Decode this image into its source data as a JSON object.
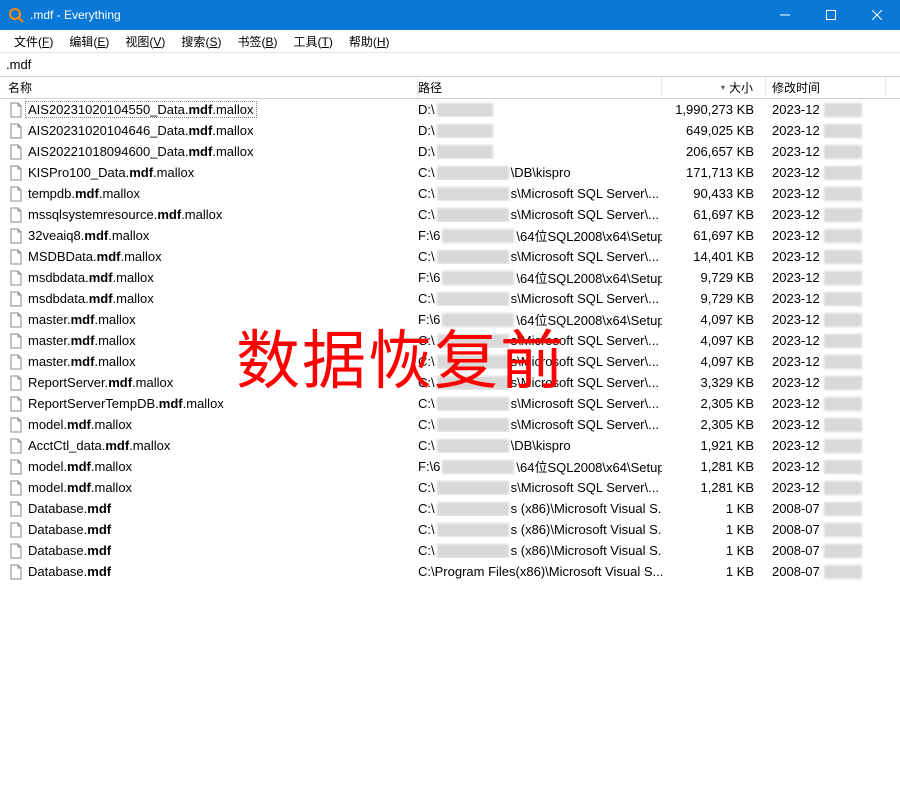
{
  "window": {
    "title": ".mdf - Everything"
  },
  "menu": {
    "file": {
      "label": "文件",
      "acc": "F"
    },
    "edit": {
      "label": "编辑",
      "acc": "E"
    },
    "view": {
      "label": "视图",
      "acc": "V"
    },
    "search": {
      "label": "搜索",
      "acc": "S"
    },
    "book": {
      "label": "书签",
      "acc": "B"
    },
    "tools": {
      "label": "工具",
      "acc": "T"
    },
    "help": {
      "label": "帮助",
      "acc": "H"
    }
  },
  "search_value": ".mdf",
  "columns": {
    "name": "名称",
    "path": "路径",
    "size": "大小",
    "date": "修改时间"
  },
  "overlay": "数据恢复前",
  "rows": [
    {
      "name_pre": "AIS20231020104550_Data.",
      "name_bold": "mdf",
      "name_post": ".mallox",
      "path_a": "D:\\",
      "path_b_w": 56,
      "path_c": "",
      "size": "1,990,273 KB",
      "date": "2023-12",
      "selected": true
    },
    {
      "name_pre": "AIS20231020104646_Data.",
      "name_bold": "mdf",
      "name_post": ".mallox",
      "path_a": "D:\\",
      "path_b_w": 56,
      "path_c": "",
      "size": "649,025 KB",
      "date": "2023-12"
    },
    {
      "name_pre": "AIS20221018094600_Data.",
      "name_bold": "mdf",
      "name_post": ".mallox",
      "path_a": "D:\\",
      "path_b_w": 56,
      "path_c": "",
      "size": "206,657 KB",
      "date": "2023-12"
    },
    {
      "name_pre": "KISPro100_Data.",
      "name_bold": "mdf",
      "name_post": ".mallox",
      "path_a": "C:\\",
      "path_b_w": 72,
      "path_c": "\\DB\\kispro",
      "size": "171,713 KB",
      "date": "2023-12"
    },
    {
      "name_pre": "tempdb.",
      "name_bold": "mdf",
      "name_post": ".mallox",
      "path_a": "C:\\",
      "path_b_w": 72,
      "path_c": "s\\Microsoft SQL Server\\...",
      "size": "90,433 KB",
      "date": "2023-12"
    },
    {
      "name_pre": "mssqlsystemresource.",
      "name_bold": "mdf",
      "name_post": ".mallox",
      "path_a": "C:\\",
      "path_b_w": 72,
      "path_c": "s\\Microsoft SQL Server\\...",
      "size": "61,697 KB",
      "date": "2023-12"
    },
    {
      "name_pre": "32veaiq8.",
      "name_bold": "mdf",
      "name_post": ".mallox",
      "path_a": "F:\\6",
      "path_b_w": 72,
      "path_c": "\\64位SQL2008\\x64\\Setup...",
      "size": "61,697 KB",
      "date": "2023-12"
    },
    {
      "name_pre": "MSDBData.",
      "name_bold": "mdf",
      "name_post": ".mallox",
      "path_a": "C:\\",
      "path_b_w": 72,
      "path_c": "s\\Microsoft SQL Server\\...",
      "size": "14,401 KB",
      "date": "2023-12"
    },
    {
      "name_pre": "msdbdata.",
      "name_bold": "mdf",
      "name_post": ".mallox",
      "path_a": "F:\\6",
      "path_b_w": 72,
      "path_c": "\\64位SQL2008\\x64\\Setup...",
      "size": "9,729 KB",
      "date": "2023-12"
    },
    {
      "name_pre": "msdbdata.",
      "name_bold": "mdf",
      "name_post": ".mallox",
      "path_a": "C:\\",
      "path_b_w": 72,
      "path_c": "s\\Microsoft SQL Server\\...",
      "size": "9,729 KB",
      "date": "2023-12"
    },
    {
      "name_pre": "master.",
      "name_bold": "mdf",
      "name_post": ".mallox",
      "path_a": "F:\\6",
      "path_b_w": 72,
      "path_c": "\\64位SQL2008\\x64\\Setup...",
      "size": "4,097 KB",
      "date": "2023-12"
    },
    {
      "name_pre": "master.",
      "name_bold": "mdf",
      "name_post": ".mallox",
      "path_a": "C:\\",
      "path_b_w": 72,
      "path_c": "s\\Microsoft SQL Server\\...",
      "size": "4,097 KB",
      "date": "2023-12"
    },
    {
      "name_pre": "master.",
      "name_bold": "mdf",
      "name_post": ".mallox",
      "path_a": "C:\\",
      "path_b_w": 72,
      "path_c": "s\\Microsoft SQL Server\\...",
      "size": "4,097 KB",
      "date": "2023-12"
    },
    {
      "name_pre": "ReportServer.",
      "name_bold": "mdf",
      "name_post": ".mallox",
      "path_a": "C:\\",
      "path_b_w": 72,
      "path_c": "s\\Microsoft SQL Server\\...",
      "size": "3,329 KB",
      "date": "2023-12"
    },
    {
      "name_pre": "ReportServerTempDB.",
      "name_bold": "mdf",
      "name_post": ".mallox",
      "path_a": "C:\\",
      "path_b_w": 72,
      "path_c": "s\\Microsoft SQL Server\\...",
      "size": "2,305 KB",
      "date": "2023-12"
    },
    {
      "name_pre": "model.",
      "name_bold": "mdf",
      "name_post": ".mallox",
      "path_a": "C:\\",
      "path_b_w": 72,
      "path_c": "s\\Microsoft SQL Server\\...",
      "size": "2,305 KB",
      "date": "2023-12"
    },
    {
      "name_pre": "AcctCtl_data.",
      "name_bold": "mdf",
      "name_post": ".mallox",
      "path_a": "C:\\",
      "path_b_w": 72,
      "path_c": "\\DB\\kispro",
      "size": "1,921 KB",
      "date": "2023-12"
    },
    {
      "name_pre": "model.",
      "name_bold": "mdf",
      "name_post": ".mallox",
      "path_a": "F:\\6",
      "path_b_w": 72,
      "path_c": "\\64位SQL2008\\x64\\Setup...",
      "size": "1,281 KB",
      "date": "2023-12"
    },
    {
      "name_pre": "model.",
      "name_bold": "mdf",
      "name_post": ".mallox",
      "path_a": "C:\\",
      "path_b_w": 72,
      "path_c": "s\\Microsoft SQL Server\\...",
      "size": "1,281 KB",
      "date": "2023-12"
    },
    {
      "name_pre": "Database.",
      "name_bold": "mdf",
      "name_post": "",
      "path_a": "C:\\",
      "path_b_w": 72,
      "path_c": "s (x86)\\Microsoft Visual S...",
      "size": "1 KB",
      "date": "2008-07"
    },
    {
      "name_pre": "Database.",
      "name_bold": "mdf",
      "name_post": "",
      "path_a": "C:\\",
      "path_b_w": 72,
      "path_c": "s (x86)\\Microsoft Visual S...",
      "size": "1 KB",
      "date": "2008-07"
    },
    {
      "name_pre": "Database.",
      "name_bold": "mdf",
      "name_post": "",
      "path_a": "C:\\",
      "path_b_w": 72,
      "path_c": "s (x86)\\Microsoft Visual S...",
      "size": "1 KB",
      "date": "2008-07"
    },
    {
      "name_pre": "Database.",
      "name_bold": "mdf",
      "name_post": "",
      "path_a": "C:\\Program Files ",
      "path_b_w": 0,
      "path_c": "(x86)\\Microsoft Visual S...",
      "size": "1 KB",
      "date": "2008-07"
    }
  ]
}
